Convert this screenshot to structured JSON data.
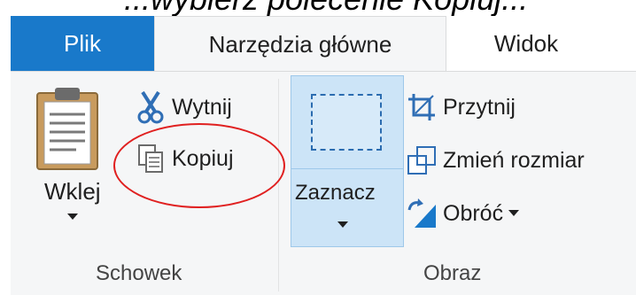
{
  "caption": "...wybierz polecenie Kopiuj...",
  "tabs": {
    "file": "Plik",
    "home": "Narzędzia główne",
    "view": "Widok"
  },
  "clipboard": {
    "paste_label": "Wklej",
    "cut_label": "Wytnij",
    "copy_label": "Kopiuj",
    "group_label": "Schowek"
  },
  "image": {
    "select_label": "Zaznacz",
    "crop_label": "Przytnij",
    "resize_label": "Zmień rozmiar",
    "rotate_label": "Obróć",
    "group_label": "Obraz"
  },
  "colors": {
    "file_tab": "#1979ca",
    "ribbon_bg": "#f5f6f7",
    "select_highlight": "#cce4f7",
    "annotation": "#e02020"
  },
  "icons": [
    "clipboard-icon",
    "scissors-icon",
    "copy-icon",
    "select-marquee-icon",
    "crop-icon",
    "resize-icon",
    "rotate-icon"
  ]
}
